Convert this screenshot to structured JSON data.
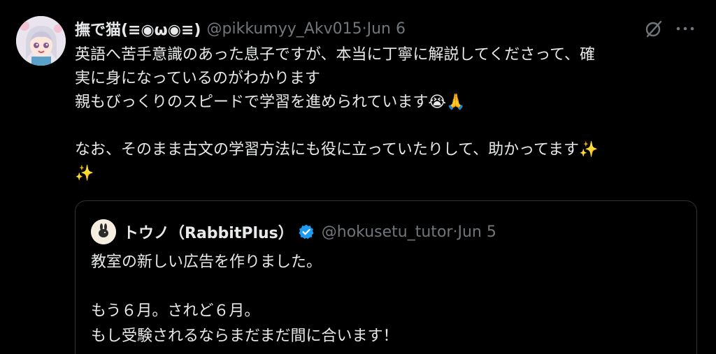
{
  "tweet": {
    "display_name": "撫で猫(≡◉ω◉≡)",
    "handle": "@pikkumyy_Akv015",
    "separator": "·",
    "date": "Jun 6",
    "lines": [
      "英語へ苦手意識のあった息子ですが、本当に丁寧に解説してくださって、確",
      "実に身になっているのがわかります",
      "親もびっくりのスピードで学習を進められています",
      "",
      "なお、そのまま古文の学習方法にも役に立っていたりして、助かってます"
    ],
    "line3_emojis": "😭🙏",
    "line5_emoji": "✨",
    "line6_emoji": "✨"
  },
  "quoted": {
    "display_name": "トウノ（RabbitPlus）",
    "handle": "@hokusetu_tutor",
    "separator": "·",
    "date": "Jun 5",
    "lines": [
      "教室の新しい広告を作りました。",
      "",
      "もう６月。されど６月。",
      "もし受験されるならまだまだ間に合います！"
    ]
  },
  "icons": {
    "grok": "grok-icon",
    "more": "more-icon",
    "verified": "verified-badge-icon"
  },
  "colors": {
    "background": "#000000",
    "text": "#e7e9ea",
    "secondary": "#71767b",
    "border": "#2f3336",
    "verified": "#1d9bf0"
  }
}
